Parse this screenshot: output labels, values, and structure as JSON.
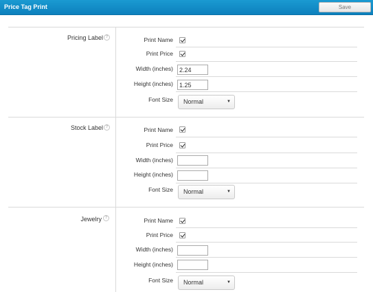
{
  "header": {
    "title": "Price Tag Print",
    "save_label": "Save"
  },
  "sections": [
    {
      "label": "Pricing Label",
      "help_icon": "?",
      "rows": {
        "print_name": {
          "label": "Print Name",
          "checked": true
        },
        "print_price": {
          "label": "Print Price",
          "checked": true
        },
        "width": {
          "label": "Width (inches)",
          "value": "2.24"
        },
        "height": {
          "label": "Height (inches)",
          "value": "1.25"
        },
        "font_size": {
          "label": "Font Size",
          "value": "Normal"
        }
      }
    },
    {
      "label": "Stock Label",
      "help_icon": "?",
      "rows": {
        "print_name": {
          "label": "Print Name",
          "checked": true
        },
        "print_price": {
          "label": "Print Price",
          "checked": true
        },
        "width": {
          "label": "Width (inches)",
          "value": ""
        },
        "height": {
          "label": "Height (inches)",
          "value": ""
        },
        "font_size": {
          "label": "Font Size",
          "value": "Normal"
        }
      }
    },
    {
      "label": "Jewelry",
      "help_icon": "?",
      "rows": {
        "print_name": {
          "label": "Print Name",
          "checked": true
        },
        "print_price": {
          "label": "Print Price",
          "checked": true
        },
        "width": {
          "label": "Width (inches)",
          "value": ""
        },
        "height": {
          "label": "Height (inches)",
          "value": ""
        },
        "font_size": {
          "label": "Font Size",
          "value": "Normal"
        }
      }
    }
  ],
  "icons": {
    "select_arrow": "▼"
  },
  "colors": {
    "header_bar": "#1a9ad2",
    "divider": "#d9d9d9"
  }
}
